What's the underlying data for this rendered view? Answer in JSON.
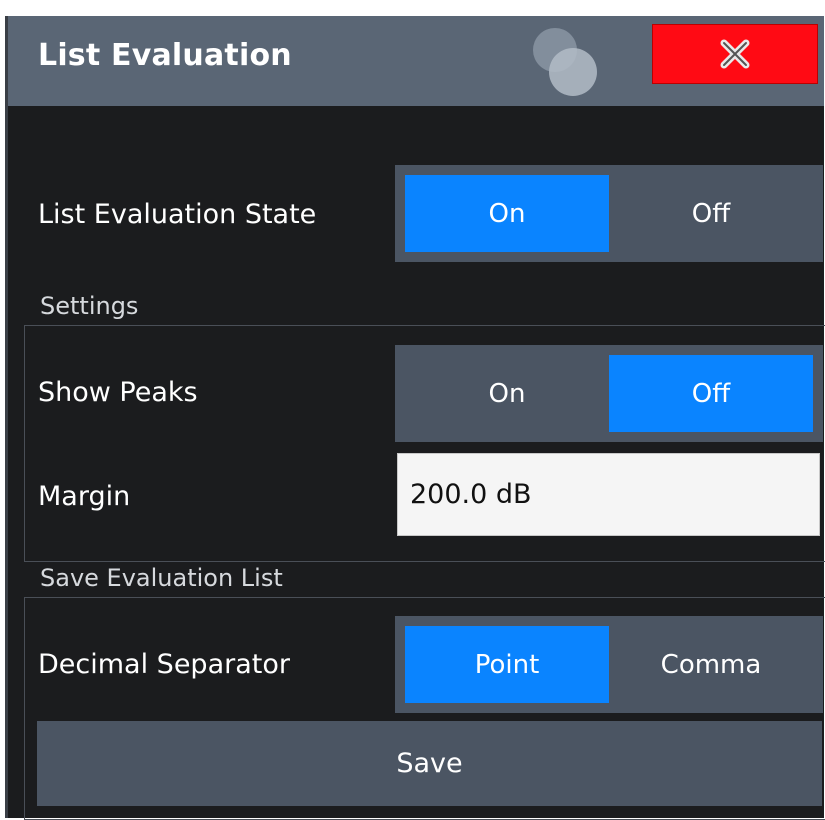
{
  "dialog": {
    "title": "List Evaluation",
    "close_label": "X"
  },
  "list_state": {
    "label": "List Evaluation State",
    "options": [
      "On",
      "Off"
    ],
    "selected": "On"
  },
  "settings": {
    "section_label": "Settings",
    "show_peaks": {
      "label": "Show Peaks",
      "options": [
        "On",
        "Off"
      ],
      "selected": "Off"
    },
    "margin": {
      "label": "Margin",
      "value": "200.0 dB"
    }
  },
  "save_list": {
    "section_label": "Save Evaluation List",
    "decimal_separator": {
      "label": "Decimal Separator",
      "options": [
        "Point",
        "Comma"
      ],
      "selected": "Point"
    },
    "save_label": "Save"
  },
  "colors": {
    "title_bar": "#5a6675",
    "background": "#1b1c1e",
    "accent_active": "#0a84ff",
    "close_red": "#ff0a14"
  }
}
